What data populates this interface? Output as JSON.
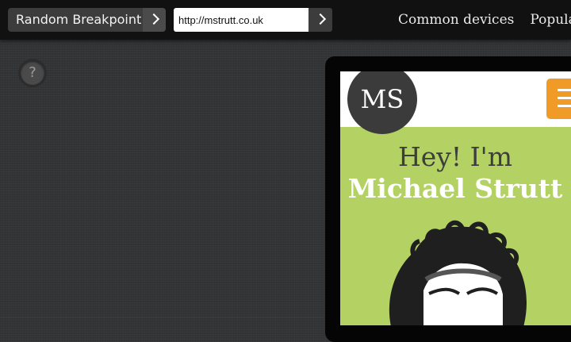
{
  "toolbar": {
    "random_label": "Random Breakpoint",
    "url_value": "http://mstrutt.co.uk",
    "nav": [
      "Common devices",
      "Popular"
    ]
  },
  "help": {
    "label": "?"
  },
  "site": {
    "logo_text": "MS",
    "hero_greeting": "Hey! I'm",
    "hero_name": "Michael Strutt",
    "accent_color": "#f09b28",
    "background_color": "#b3d263"
  }
}
